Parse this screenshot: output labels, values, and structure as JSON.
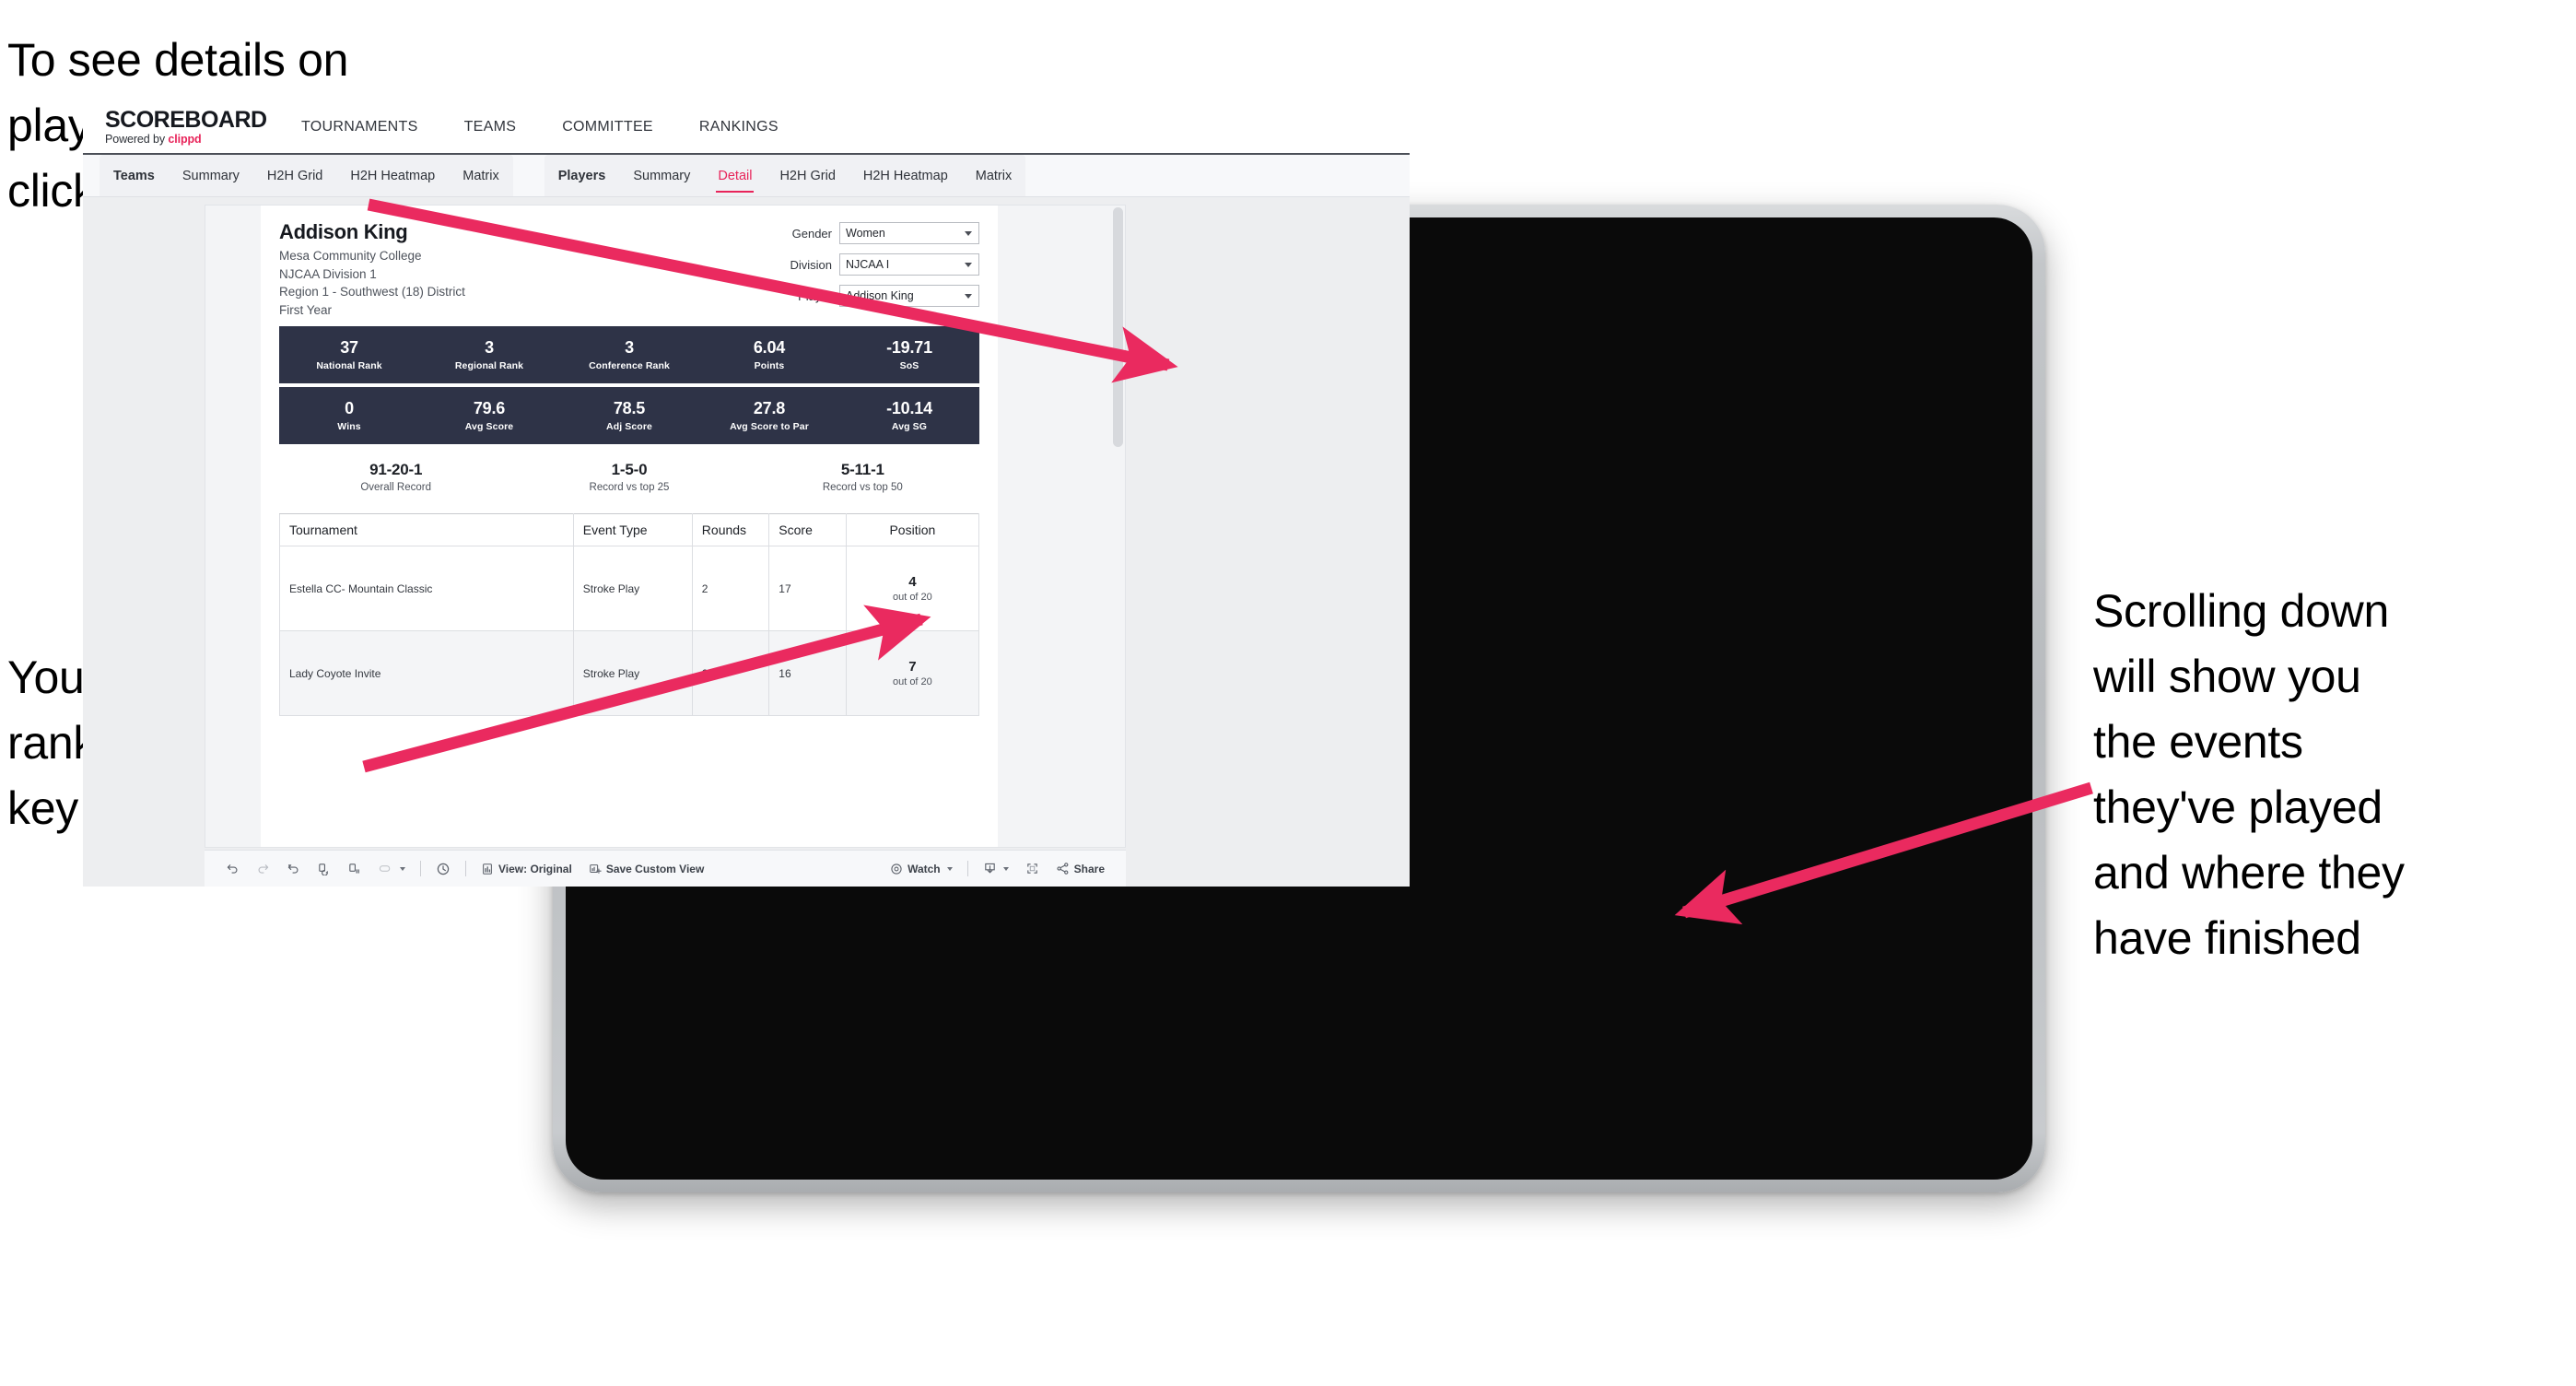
{
  "annotations": {
    "detail_note": "To see details on\nplayer performances\nclick ",
    "detail_note_bold": "Detail",
    "rankings_note": "You can see\nrankings and\nkey information",
    "scroll_note": "Scrolling down\nwill show you\nthe events\nthey've played\nand where they\nhave finished"
  },
  "colors": {
    "accent_pink": "#e8245a",
    "arrow_pink": "#ea2a5f",
    "stat_navy": "#2e3347",
    "screen_bg": "#edeef0"
  },
  "app": {
    "brand": {
      "title": "SCOREBOARD",
      "powered_prefix": "Powered by ",
      "powered_name": "clippd"
    },
    "topnav": [
      {
        "label": "TOURNAMENTS"
      },
      {
        "label": "TEAMS"
      },
      {
        "label": "COMMITTEE"
      },
      {
        "label": "RANKINGS"
      }
    ],
    "subtabs": {
      "teams_group": [
        {
          "label": "Teams",
          "lead": true,
          "active": false
        },
        {
          "label": "Summary",
          "lead": false,
          "active": false
        },
        {
          "label": "H2H Grid",
          "lead": false,
          "active": false
        },
        {
          "label": "H2H Heatmap",
          "lead": false,
          "active": false
        },
        {
          "label": "Matrix",
          "lead": false,
          "active": false
        }
      ],
      "players_group": [
        {
          "label": "Players",
          "lead": true,
          "active": false
        },
        {
          "label": "Summary",
          "lead": false,
          "active": false
        },
        {
          "label": "Detail",
          "lead": false,
          "active": true
        },
        {
          "label": "H2H Grid",
          "lead": false,
          "active": false
        },
        {
          "label": "H2H Heatmap",
          "lead": false,
          "active": false
        },
        {
          "label": "Matrix",
          "lead": false,
          "active": false
        }
      ]
    }
  },
  "player": {
    "name": "Addison King",
    "school": "Mesa Community College",
    "division": "NJCAA Division 1",
    "region": "Region 1 - Southwest (18) District",
    "class_year": "First Year"
  },
  "filters": [
    {
      "label": "Gender",
      "value": "Women"
    },
    {
      "label": "Division",
      "value": "NJCAA I"
    },
    {
      "label": "Player",
      "value": "Addison King"
    }
  ],
  "stats_row_1": [
    {
      "value": "37",
      "label": "National Rank"
    },
    {
      "value": "3",
      "label": "Regional Rank"
    },
    {
      "value": "3",
      "label": "Conference Rank"
    },
    {
      "value": "6.04",
      "label": "Points"
    },
    {
      "value": "-19.71",
      "label": "SoS"
    }
  ],
  "stats_row_2": [
    {
      "value": "0",
      "label": "Wins"
    },
    {
      "value": "79.6",
      "label": "Avg Score"
    },
    {
      "value": "78.5",
      "label": "Adj Score"
    },
    {
      "value": "27.8",
      "label": "Avg Score to Par"
    },
    {
      "value": "-10.14",
      "label": "Avg SG"
    }
  ],
  "records": [
    {
      "value": "91-20-1",
      "label": "Overall Record"
    },
    {
      "value": "1-5-0",
      "label": "Record vs top 25"
    },
    {
      "value": "5-11-1",
      "label": "Record vs top 50"
    }
  ],
  "tournament_table": {
    "headers": [
      "Tournament",
      "Event Type",
      "Rounds",
      "Score",
      "Position"
    ],
    "rows": [
      {
        "tournament": "Estella CC- Mountain Classic",
        "event_type": "Stroke Play",
        "rounds": "2",
        "score": "17",
        "position_num": "4",
        "position_outof": "out of 20"
      },
      {
        "tournament": "Lady Coyote Invite",
        "event_type": "Stroke Play",
        "rounds": "2",
        "score": "16",
        "position_num": "7",
        "position_outof": "out of 20"
      }
    ]
  },
  "toolbar": {
    "view_label": "View: Original",
    "save_label": "Save Custom View",
    "watch_label": "Watch",
    "share_label": "Share"
  }
}
